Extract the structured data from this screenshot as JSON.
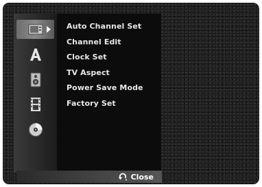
{
  "menu": {
    "icons": [
      {
        "name": "general-icon",
        "selected": true
      },
      {
        "name": "language-icon",
        "selected": false
      },
      {
        "name": "audio-icon",
        "selected": false
      },
      {
        "name": "recording-icon",
        "selected": false
      },
      {
        "name": "disc-icon",
        "selected": false
      }
    ],
    "items": [
      {
        "label": "Auto Channel Set"
      },
      {
        "label": "Channel Edit"
      },
      {
        "label": "Clock Set"
      },
      {
        "label": "TV Aspect"
      },
      {
        "label": "Power Save Mode"
      },
      {
        "label": "Factory Set"
      }
    ]
  },
  "footer": {
    "close_icon": "return-icon",
    "close_label": "Close"
  }
}
